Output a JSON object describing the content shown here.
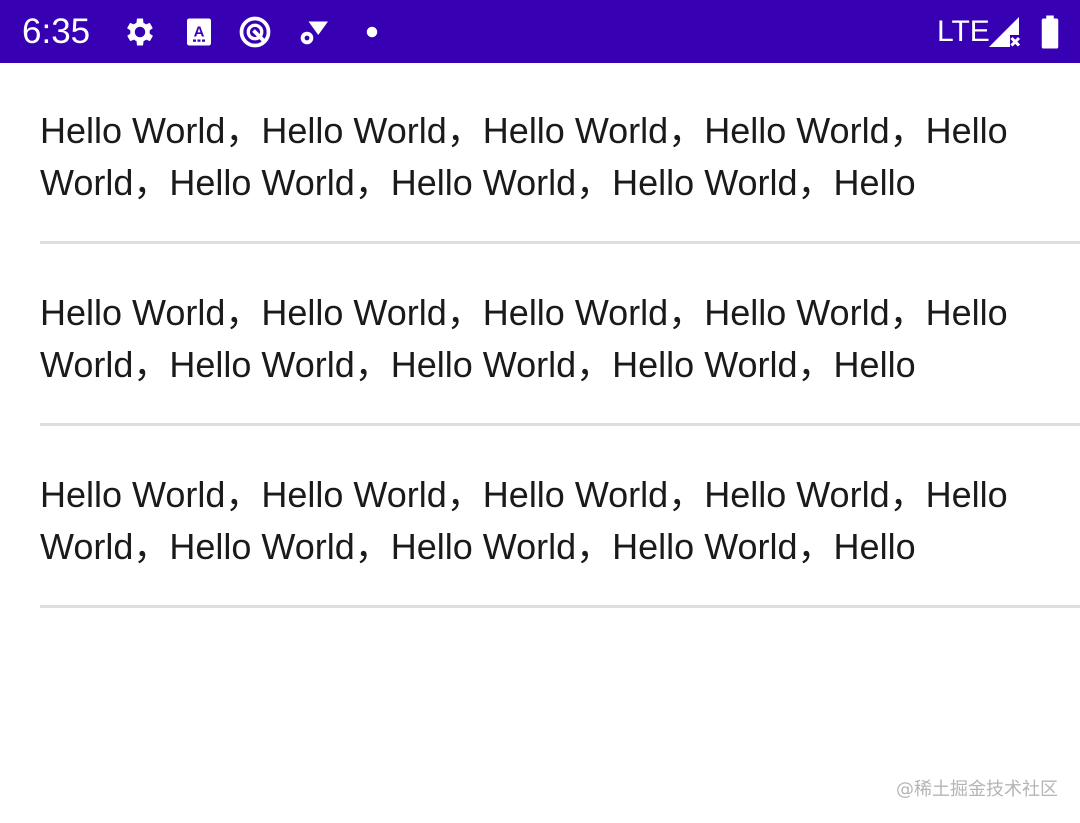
{
  "status_bar": {
    "time": "6:35",
    "network": "LTE",
    "background_color": "#3700B3",
    "icons_left": [
      "gear-icon",
      "font-a-icon",
      "circle-slash-icon",
      "wifi-gear-icon",
      "dot-icon"
    ],
    "icons_right": [
      "signal-off-icon",
      "battery-icon"
    ]
  },
  "list": {
    "items": [
      {
        "text": "Hello World，Hello World，Hello World，Hello World，Hello World，Hello World，Hello World，Hello World，Hello"
      },
      {
        "text": "Hello World，Hello World，Hello World，Hello World，Hello World，Hello World，Hello World，Hello World，Hello"
      },
      {
        "text": "Hello World，Hello World，Hello World，Hello World，Hello World，Hello World，Hello World，Hello World，Hello"
      }
    ]
  },
  "watermark": "@稀土掘金技术社区"
}
